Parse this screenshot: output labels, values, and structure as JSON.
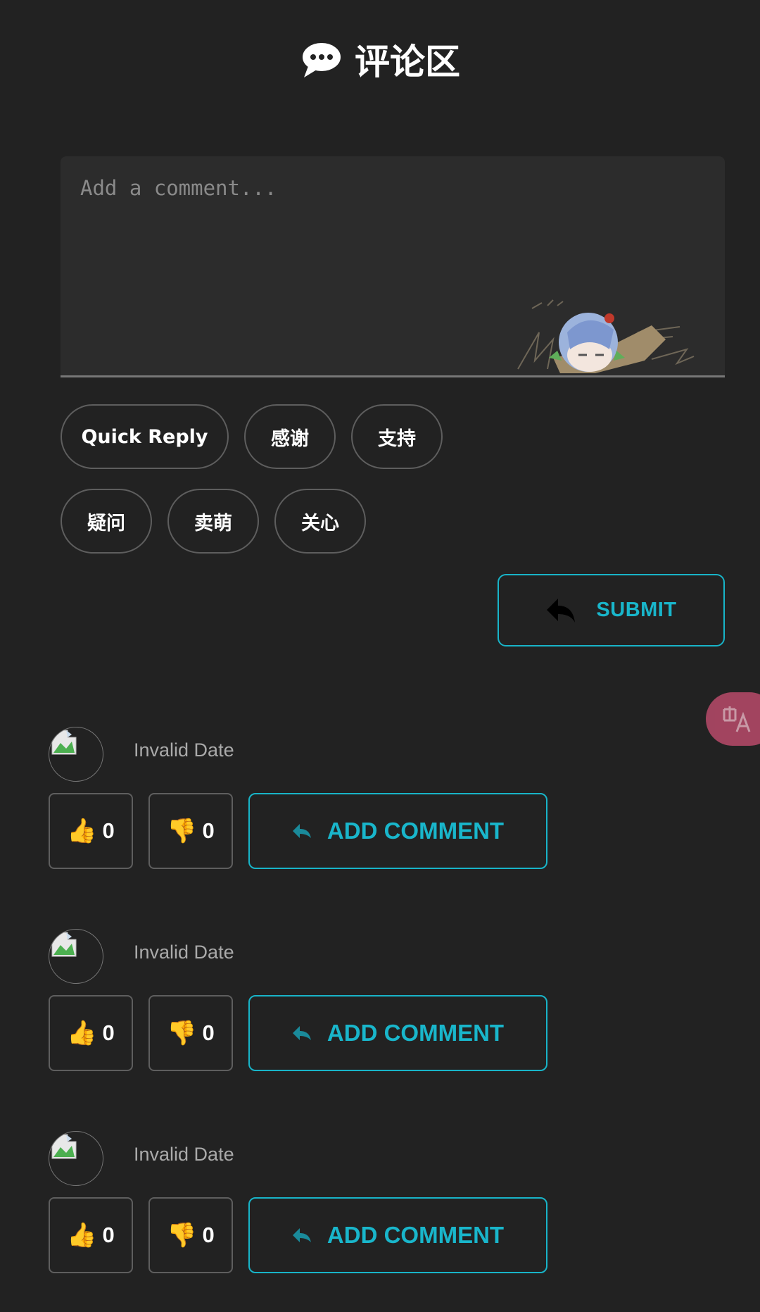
{
  "header": {
    "title": "评论区",
    "icon": "speech-bubble-icon"
  },
  "composer": {
    "placeholder": "Add a comment...",
    "value": "",
    "quick_replies": [
      "Quick Reply",
      "感谢",
      "支持",
      "疑问",
      "卖萌",
      "关心"
    ],
    "submit_label": "SUBMIT",
    "submit_icon": "reply-arrow-icon"
  },
  "translate_button": {
    "icon": "translate-icon"
  },
  "comments": [
    {
      "date": "Invalid Date",
      "likes": "0",
      "dislikes": "0",
      "add_label": "ADD COMMENT"
    },
    {
      "date": "Invalid Date",
      "likes": "0",
      "dislikes": "0",
      "add_label": "ADD COMMENT"
    },
    {
      "date": "Invalid Date",
      "likes": "0",
      "dislikes": "0",
      "add_label": "ADD COMMENT"
    }
  ],
  "colors": {
    "accent": "#19b6cb",
    "background": "#222222",
    "fab": "#c24d6f"
  }
}
